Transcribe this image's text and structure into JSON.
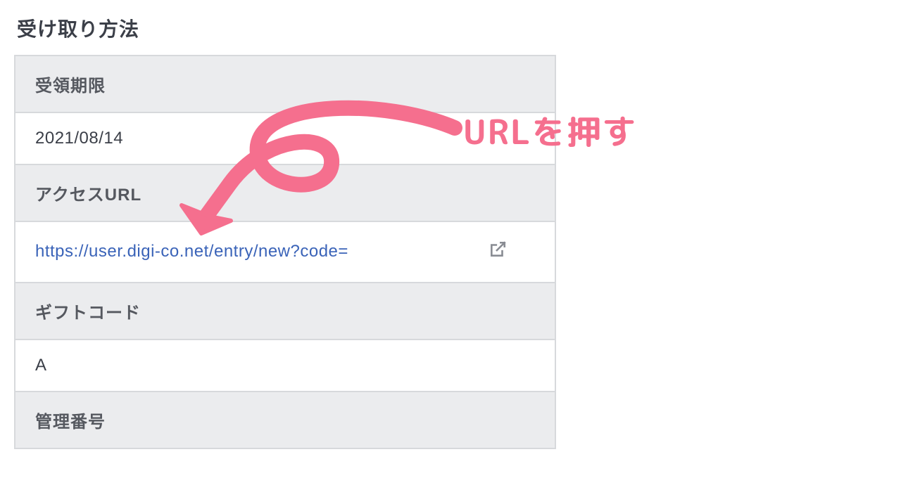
{
  "section_title": "受け取り方法",
  "rows": {
    "deadline_label": "受領期限",
    "deadline_value": "2021/08/14",
    "access_url_label": "アクセスURL",
    "access_url_value": "https://user.digi-co.net/entry/new?code=",
    "gift_code_label": "ギフトコード",
    "gift_code_value": "A",
    "mgmt_number_label": "管理番号"
  },
  "annotation_text": "URLを押す",
  "colors": {
    "accent_pink": "#f56f8e",
    "link_blue": "#3a63b8",
    "header_bg": "#ebecee",
    "border": "#d7d9dc"
  }
}
